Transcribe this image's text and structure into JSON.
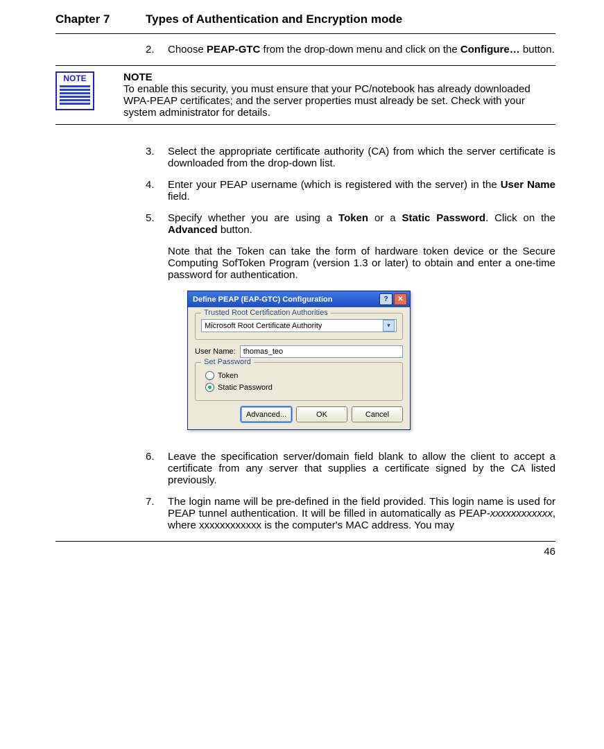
{
  "header": {
    "chapter_num": "Chapter 7",
    "chapter_title": "Types of Authentication and Encryption mode"
  },
  "steps": {
    "s2": {
      "num": "2.",
      "text_a": "Choose ",
      "bold_a": "PEAP-GTC",
      "text_b": " from the drop-down menu and click on the ",
      "bold_b": "Configure…",
      "text_c": " button."
    },
    "s3": {
      "num": "3.",
      "text": "Select the appropriate certificate authority (CA) from which the server certificate is downloaded from the drop-down list."
    },
    "s4": {
      "num": "4.",
      "text_a": "Enter your PEAP username (which is registered with the server) in the ",
      "bold_a": "User Name",
      "text_b": " field."
    },
    "s5": {
      "num": "5.",
      "text_a": "Specify whether you are using a ",
      "bold_a": "Token",
      "text_b": " or a ",
      "bold_b": "Static Password",
      "text_c": ". Click on the ",
      "bold_c": "Advanced",
      "text_d": " button.",
      "note": "Note that the Token can take the form of hardware token device or the Secure Computing SofToken Program (version 1.3 or later) to obtain and enter a one-time password for authentication."
    },
    "s6": {
      "num": "6.",
      "text": "Leave the specification server/domain field blank to allow the client to accept a certificate from any server that supplies a certificate signed by the CA listed previously."
    },
    "s7": {
      "num": "7.",
      "text_a": "The login name will be pre-defined in the field provided. This login name is used for PEAP tunnel authentication. It will be filled in automatically as PEAP-",
      "italic_a": "xxxxxxxxxxxx",
      "text_b": ", where xxxxxxxxxxxx is the computer's MAC address. You may"
    }
  },
  "note_block": {
    "icon_label": "NOTE",
    "heading": "NOTE",
    "body": "To enable this security, you must ensure that your PC/notebook has already downloaded WPA-PEAP certificates; and the server properties must already be set. Check with your system administrator for details."
  },
  "dialog": {
    "title": "Define PEAP (EAP-GTC) Configuration",
    "help_glyph": "?",
    "close_glyph": "✕",
    "ca_legend": "Trusted Root Certification Authorities",
    "ca_value": "Microsoft Root Certificate Authority",
    "dropdown_glyph": "▾",
    "username_label": "User Name:",
    "username_value": "thomas_teo",
    "setpw_legend": "Set Password",
    "radio_token": "Token",
    "radio_static": "Static Password",
    "btn_advanced": "Advanced...",
    "btn_ok": "OK",
    "btn_cancel": "Cancel"
  },
  "footer": {
    "page_num": "46"
  }
}
